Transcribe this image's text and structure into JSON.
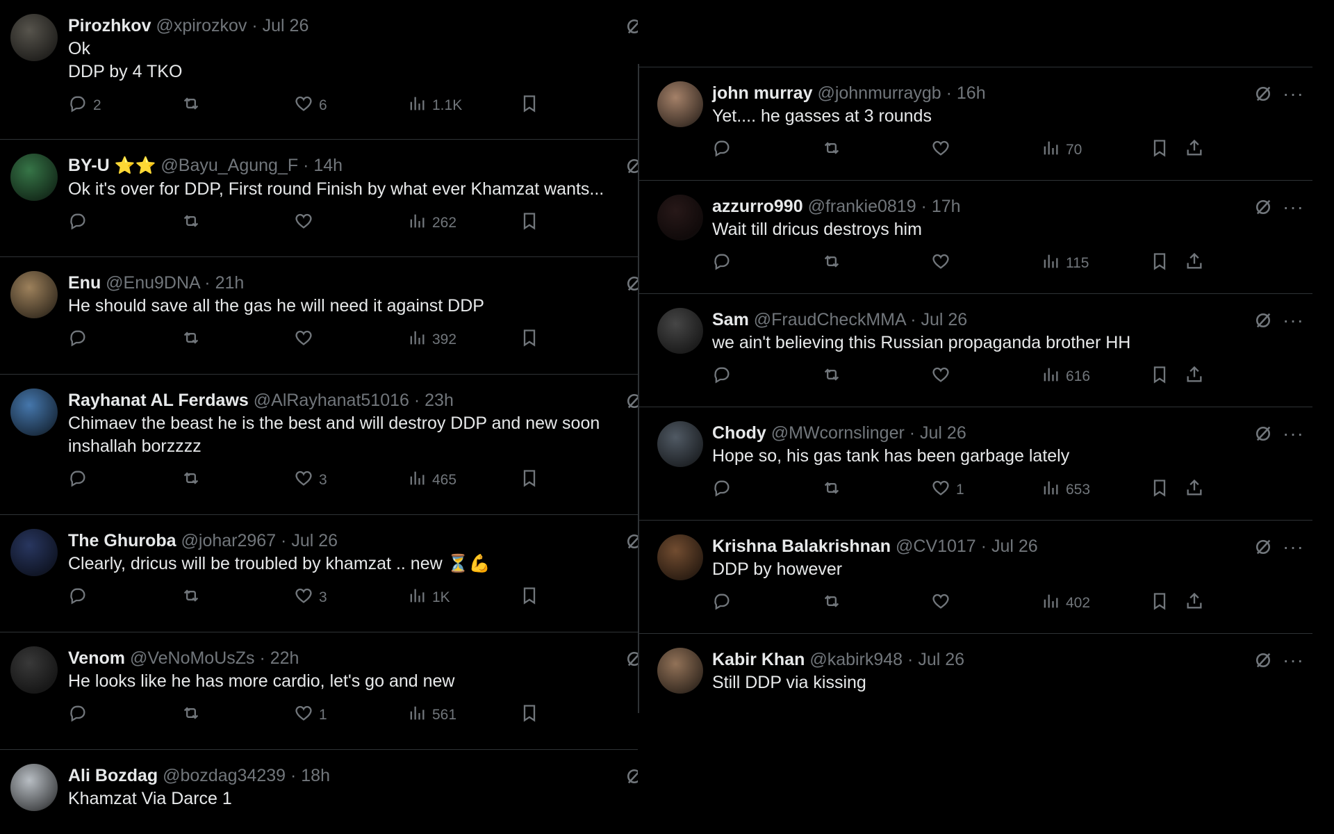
{
  "left_tweets": [
    {
      "name": "Pirozhkov",
      "handle": "@xpirozkov",
      "time": "Jul 26",
      "lines": [
        "Ok",
        "DDP by 4 TKO"
      ],
      "replies": "2",
      "likes": "6",
      "views": "1.1K",
      "avatar": "#5d5a52"
    },
    {
      "name": "BY-U",
      "stars": "⭐⭐",
      "handle": "@Bayu_Agung_F",
      "time": "14h",
      "lines": [
        "Ok it's over for DDP, First round Finish by what ever Khamzat wants..."
      ],
      "replies": "",
      "likes": "",
      "views": "262",
      "avatar": "#3a7d4c"
    },
    {
      "name": "Enu",
      "handle": "@Enu9DNA",
      "time": "21h",
      "lines": [
        "He should save all the gas he will need it against DDP"
      ],
      "replies": "",
      "likes": "",
      "views": "392",
      "avatar": "#a88a62"
    },
    {
      "name": "Rayhanat AL Ferdaws",
      "handle": "@AlRayhanat51016",
      "time": "23h",
      "lines": [
        "Chimaev the beast he is the best and will destroy DDP and new soon",
        "inshallah borzzzz"
      ],
      "replies": "",
      "likes": "3",
      "views": "465",
      "avatar": "#4a7fb8"
    },
    {
      "name": "The Ghuroba",
      "handle": "@johar2967",
      "time": "Jul 26",
      "lines": [
        "Clearly, dricus will be troubled by khamzat .. new ⏳💪"
      ],
      "replies": "",
      "likes": "3",
      "views": "1K",
      "avatar": "#2b3a66"
    },
    {
      "name": "Venom",
      "handle": "@VeNoMoUsZs",
      "time": "22h",
      "lines": [
        "He looks like he has more cardio, let's go and new"
      ],
      "replies": "",
      "likes": "1",
      "views": "561",
      "avatar": "#3d3d3d"
    },
    {
      "name": "Ali Bozdag",
      "handle": "@bozdag34239",
      "time": "18h",
      "lines": [
        "Khamzat Via Darce 1"
      ],
      "replies": "",
      "likes": "",
      "views": "",
      "avatar": "#c5cbd1"
    }
  ],
  "right_tweets": [
    {
      "name": "john murray",
      "handle": "@johnmurraygb",
      "time": "16h",
      "lines": [
        "Yet.... he gasses at 3 rounds"
      ],
      "replies": "",
      "likes": "",
      "views": "70",
      "avatar": "#b08a70"
    },
    {
      "name": "azzurro990",
      "handle": "@frankie0819",
      "time": "17h",
      "lines": [
        "Wait till dricus destroys him"
      ],
      "replies": "",
      "likes": "",
      "views": "115",
      "avatar": "#2a1a1a"
    },
    {
      "name": "Sam",
      "handle": "@FraudCheckMMA",
      "time": "Jul 26",
      "lines": [
        "we ain't believing this Russian propaganda brother HH"
      ],
      "replies": "",
      "likes": "",
      "views": "616",
      "avatar": "#4b4b4b"
    },
    {
      "name": "Chody",
      "handle": "@MWcornslinger",
      "time": "Jul 26",
      "lines": [
        "Hope so, his gas tank has been garbage lately"
      ],
      "replies": "",
      "likes": "1",
      "views": "653",
      "avatar": "#56606b"
    },
    {
      "name": "Krishna Balakrishnan",
      "handle": "@CV1017",
      "time": "Jul 26",
      "lines": [
        "DDP by however"
      ],
      "replies": "",
      "likes": "",
      "views": "402",
      "avatar": "#7a5234"
    },
    {
      "name": "Kabir Khan",
      "handle": "@kabirk948",
      "time": "Jul 26",
      "lines": [
        "Still DDP via kissing"
      ],
      "replies": "",
      "likes": "",
      "views": "",
      "avatar": "#9c7a5e"
    }
  ],
  "icons": {
    "reply": "reply-icon",
    "retweet": "retweet-icon",
    "like": "heart-icon",
    "views": "views-icon",
    "bookmark": "bookmark-icon",
    "share": "share-icon",
    "grok": "grok-icon",
    "more": "more-icon"
  },
  "more_glyph": "···"
}
